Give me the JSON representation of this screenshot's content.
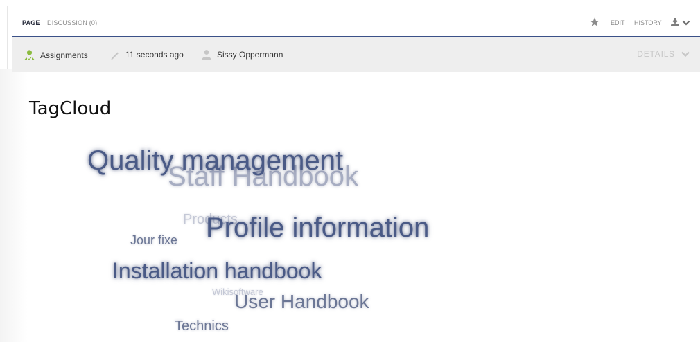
{
  "tabs": {
    "page": "PAGE",
    "discussion": "DISCUSSION (0)",
    "edit": "EDIT",
    "history": "HISTORY"
  },
  "info": {
    "category": "Assignments",
    "modified": "11 seconds ago",
    "author": "Sissy Oppermann",
    "details": "DETAILS"
  },
  "page_title": "TagCloud",
  "tags": {
    "quality": "Quality management",
    "staff": "Staff Handbook",
    "products": "Products",
    "jourfixe": "Jour fixe",
    "profile": "Profile information",
    "installation": "Installation handbook",
    "wikisoftware": "Wikisoftware",
    "user": "User Handbook",
    "technics": "Technics"
  },
  "icons": {
    "star": "star-icon",
    "history_menu": "history-icon",
    "assignments": "user-icon",
    "pencil": "pencil-icon",
    "author": "user-icon"
  },
  "colors": {
    "accent": "#3b5188",
    "tag_dark": "#4a5a86",
    "tag_mid": "#6b7695",
    "tag_light": "#a7adc2"
  }
}
